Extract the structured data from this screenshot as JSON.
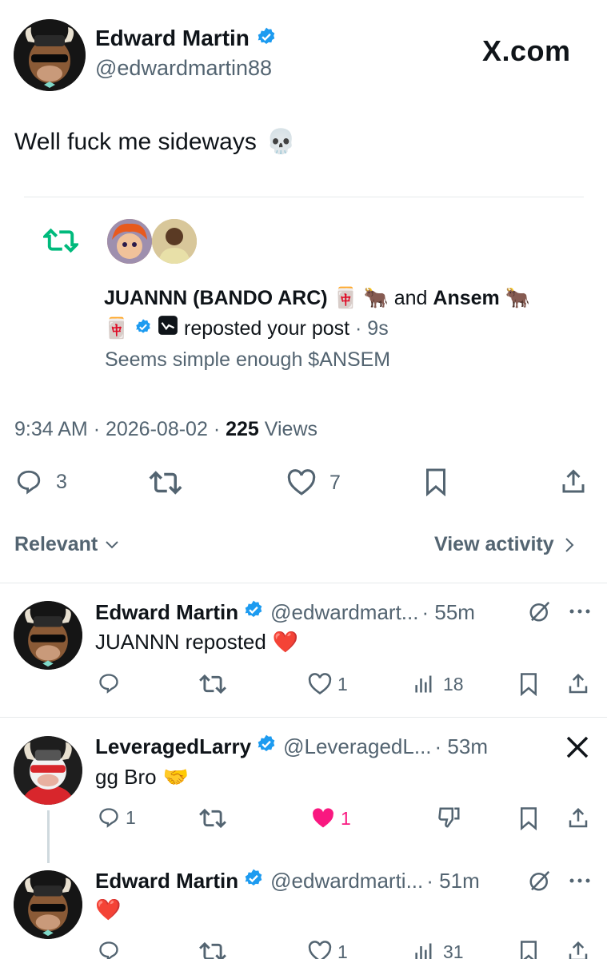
{
  "post": {
    "author_name": "Edward Martin",
    "author_handle": "@edwardmartin88",
    "site_label": "X.com",
    "text": "Well fuck me sideways",
    "emoji": "💀",
    "timestamp": "9:34 AM",
    "date": "2026-08-02",
    "views_count": "225",
    "views_label": "Views"
  },
  "notification": {
    "user1_name": "JUANNN (BANDO ARC)",
    "user1_emoji": "🀄 🐂",
    "and_text": "and",
    "user2_name": "Ansem",
    "user2_emoji": "🐂",
    "user2_emoji2": "🀄",
    "action_text": "reposted your post",
    "time": "· 9s",
    "quote": "Seems simple enough $ANSEM"
  },
  "actions": {
    "replies": "3",
    "likes": "7"
  },
  "sort": {
    "relevant_label": "Relevant",
    "view_activity_label": "View activity"
  },
  "replies": [
    {
      "name": "Edward Martin",
      "handle": "@edwardmart...",
      "time": "· 55m",
      "text": "JUANNN reposted",
      "emoji": "❤️",
      "reply_count": "",
      "like_count": "1",
      "views": "18"
    },
    {
      "name": "LeveragedLarry",
      "handle": "@LeveragedL...",
      "time": "· 53m",
      "text": "gg Bro",
      "emoji": "🤝",
      "reply_count": "1",
      "like_count": "1"
    },
    {
      "name": "Edward Martin",
      "handle": "@edwardmarti...",
      "time": "· 51m",
      "text": "",
      "emoji": "❤️",
      "like_count": "1",
      "views": "31"
    }
  ],
  "colors": {
    "accent": "#1d9bf0",
    "repost_green": "#00ba7c",
    "like_pink": "#f91880",
    "text": "#0f1419",
    "muted": "#536471"
  }
}
